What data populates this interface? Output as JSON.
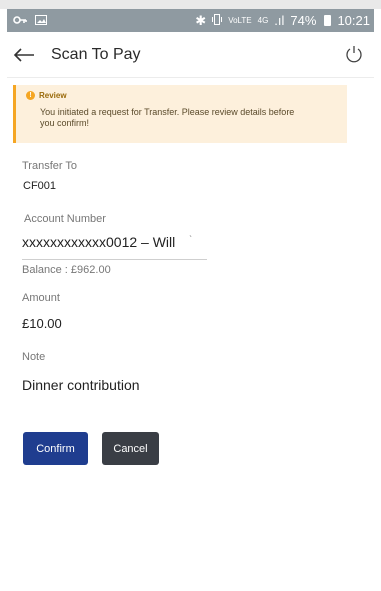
{
  "status_bar": {
    "bt": "✱",
    "volte": "VoLTE",
    "lte": "4G",
    "signal": ".ıl",
    "battery": "74%",
    "time": "10:21"
  },
  "header": {
    "title": "Scan To Pay"
  },
  "review": {
    "title": "Review",
    "message": "You initiated a request for Transfer. Please review details before you confirm!"
  },
  "form": {
    "transfer_to_label": "Transfer  To",
    "transfer_to_value": "CF001",
    "account_label": "Account Number",
    "account_value": "xxxxxxxxxxxx0012 – Will",
    "balance": "Balance : £962.00",
    "amount_label": "Amount",
    "amount_value": "£10.00",
    "note_label": "Note",
    "note_value": "Dinner contribution"
  },
  "buttons": {
    "confirm": "Confirm",
    "cancel": "Cancel"
  },
  "colors": {
    "primary": "#1f3d8f",
    "secondary": "#3a3e45",
    "warning": "#f5a623",
    "warning_bg": "#fdf0dc"
  }
}
